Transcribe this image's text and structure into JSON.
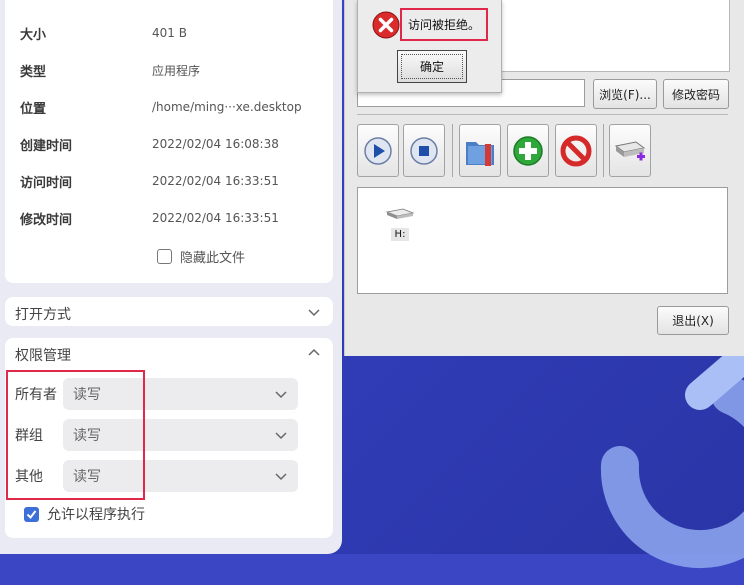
{
  "properties": {
    "rows": [
      {
        "label": "大小",
        "value": "401 B"
      },
      {
        "label": "类型",
        "value": "应用程序"
      },
      {
        "label": "位置",
        "value": "/home/ming···xe.desktop"
      },
      {
        "label": "创建时间",
        "value": "2022/02/04 16:08:38"
      },
      {
        "label": "访问时间",
        "value": "2022/02/04 16:33:51"
      },
      {
        "label": "修改时间",
        "value": "2022/02/04 16:33:51"
      }
    ],
    "hide_file_label": "隐藏此文件"
  },
  "open_with": {
    "title": "打开方式"
  },
  "permissions": {
    "title": "权限管理",
    "rows": [
      {
        "label": "所有者",
        "value": "读写"
      },
      {
        "label": "群组",
        "value": "读写"
      },
      {
        "label": "其他",
        "value": "读写"
      }
    ],
    "exec_label": "允许以程序执行",
    "exec_checked": true
  },
  "dialog": {
    "browse_label": "浏览(F)...",
    "change_password_label": "修改密码",
    "drive_label": "H:",
    "exit_label": "退出(X)"
  },
  "message": {
    "text": "访问被拒绝。",
    "ok_label": "确定"
  },
  "colors": {
    "highlight_red": "#e0294a",
    "accent_blue": "#3d6fd8",
    "desktop_blue": "#3a46c4"
  }
}
